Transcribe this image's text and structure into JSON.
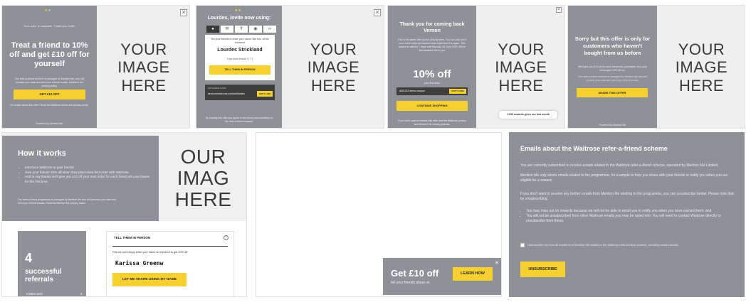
{
  "image_placeholder": "YOUR IMAGE HERE",
  "image_placeholder_clip": "OUR IMAG HERE",
  "p1": {
    "complete_text": "Your order is complete. Thank you, Kylie.",
    "headline": "Treat a friend to 10% off and get £10 off for yourself",
    "body": "Our refer-a-friend scheme is managed by Mention Me, who will process your data and send you referral emails. Details in the privacy policy.",
    "button": "GET £10 OFF",
    "footnote": "No emails about this offer? Read the Waitrose terms and privacy policy.",
    "powered": "Powered by Mention Me"
  },
  "p2": {
    "title": "Lourdes, invite now using:",
    "share_icons": [
      "speech-icon",
      "email-icon",
      "facebook-icon",
      "messenger-icon",
      "link-icon"
    ],
    "instruction": "Tell your friends to enter your name, like this, at the checkout",
    "name": "Lourdes Strickland",
    "how_link": "How does it work? [ ? ]",
    "button": "TELL THEM IN PERSON",
    "share_label": "OR SHARE A LINK",
    "link": "demo.mention-me.com/m/ol/lo/abc",
    "copy": "COPY LINK",
    "footnote": "By sharing this offer you agree to the terms and conditions of the refer-a-friend scheme."
  },
  "p3": {
    "title": "Thank you for coming back Vernon",
    "body": "This is the same offer you've already seen. You can only use it once but in case you haven't used it yet here it is again. This reward is valid for 7 days until Monday, 26 June 2023. We've also emailed this to you.",
    "offer": "10% off",
    "offer_sub": "your first order",
    "code": "ABC123 demo coupon",
    "copy": "COPY CODE",
    "button": "CONTINUE SHOPPING",
    "footnote": "If you don't want to receive this offer, see the Waitrose privacy and Mention Me privacy policies.",
    "rewards": "1,543 rewards given our last month"
  },
  "p4": {
    "title": "Sorry but this offer is only for customers who haven't bought from us before",
    "body": "We'll give you £10 off for each friend who purchases. And your friend gets 10% off too.",
    "small": "Our refer-a-friend scheme is managed by Mention Me who will process your data and send you referral emails.",
    "button": "SHARE THIS OFFER",
    "powered": "Powered by Mention Me"
  },
  "p5": {
    "title": "How it works",
    "bullets": [
      "Introduce Waitrose to your friends.",
      "Give your friends 10% off when they place their first order with Waitrose.",
      "And to say thanks we'll give you £10 off your next order for each friend who purchases for the first time."
    ],
    "small": "Our refer-a-friend programme is managed by Mention Me who will process your data and send you referral emails. Read the Mention Me privacy notice.",
    "referrals_count": "4",
    "referrals_label": "successful referrals",
    "invites_label": "Invites sent",
    "invites_value": "6",
    "tab_title": "TELL THEM IN PERSON",
    "tab_desc": "Friends can simply enter your name at checkout to get 10% off",
    "name": "Karissa Greenw",
    "button": "LET ME SHARE USING MY NAME"
  },
  "p6": {
    "headline": "Get £10 off",
    "sub": "tell your friends about us",
    "button": "LEARN HOW"
  },
  "p7": {
    "title": "Emails about the Waitrose refer-a-friend scheme",
    "para1": "You are currently subscribed to receive emails related to the Waitrose refer-a-friend scheme, operated by Mention Me Limited.",
    "para2": "Mention Me only sends emails related to the programme, for example to help you share with your friends or notify you when you are eligible for a reward.",
    "para3": "If you don't want to receive any further emails from Mention Me relating to the programme, you can unsubscribe below. Please note that by unsubscribing:",
    "bullets": [
      "You may miss out on rewards because we will not be able to email you to notify you when you have earned them; and",
      "You will not be unsubscribed from other Waitrose emails you may be opted into. You will need to contact Waitrose directly to unsubscribe from these."
    ],
    "checkbox_label": "Unsubscribe me from all emails from Mention Me related to the Waitrose refer-a-friend scheme, including reward emails.",
    "button": "UNSUBSCRIBE"
  }
}
